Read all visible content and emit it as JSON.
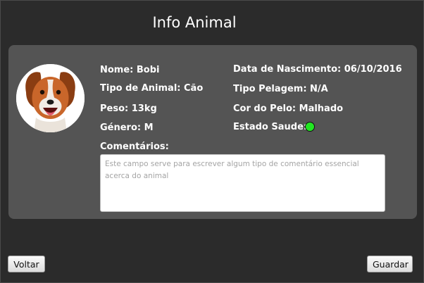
{
  "window": {
    "title": "Info Animal"
  },
  "animal": {
    "nome": "Nome: Bobi",
    "tipo": "Tipo de Animal: Cão",
    "peso": "Peso: 13kg",
    "genero": "Género: M",
    "data_nascimento": "Data de Nascimento: 06/10/2016",
    "tipo_pelagem": "Tipo Pelagem: N/A",
    "cor_pelo": "Cor do Pelo: Malhado",
    "estado_saude_label": "Estado Saude:",
    "estado_saude_color": "#22e622"
  },
  "comments": {
    "label": "Comentários:",
    "placeholder": "Este campo serve para escrever algum tipo de comentário essencial acerca do animal",
    "value": ""
  },
  "buttons": {
    "back": "Voltar",
    "save": "Guardar"
  },
  "icons": {
    "avatar": "dog-photo"
  }
}
